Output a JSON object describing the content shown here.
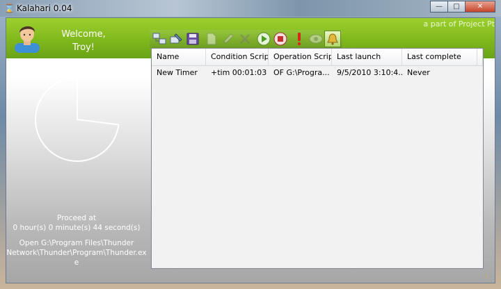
{
  "window": {
    "title": "Kalahari 0.04",
    "title_icon": "hourglass-icon",
    "controls": {
      "minimize": "—",
      "maximize": "□",
      "close": "✕"
    }
  },
  "header": {
    "welcome_line1": "Welcome,",
    "welcome_line2": "Troy!",
    "part_of": "a part of Project Pt",
    "avatar_icon": "user-avatar-icon",
    "accent_color": "#7fb81d"
  },
  "timer": {
    "pie_remaining_fraction": 0.27,
    "proceed_label": "Proceed at",
    "remaining": "0 hour(s) 0 minute(s) 44 second(s)",
    "open_action_line1": "Open G:\\Program Files\\Thunder",
    "open_action_line2": "Network\\Thunder\\Program\\Thunder.ex",
    "open_action_line3": "e"
  },
  "toolbar": {
    "buttons": [
      {
        "icon": "network-icon",
        "enabled": true
      },
      {
        "icon": "network-edit-icon",
        "enabled": true
      },
      {
        "icon": "save-icon",
        "enabled": true
      },
      {
        "icon": "new-document-icon",
        "enabled": false
      },
      {
        "icon": "edit-pencil-icon",
        "enabled": false
      },
      {
        "icon": "delete-cross-icon",
        "enabled": false
      },
      {
        "icon": "play-icon",
        "enabled": true
      },
      {
        "icon": "stop-icon",
        "enabled": true
      },
      {
        "icon": "alert-exclamation-icon",
        "enabled": true
      },
      {
        "icon": "view-eye-icon",
        "enabled": false
      },
      {
        "icon": "bell-icon",
        "enabled": true,
        "active": true
      }
    ]
  },
  "list": {
    "columns": [
      "Name",
      "Condition Script",
      "Operation Script",
      "Last launch",
      "Last complete"
    ],
    "rows": [
      {
        "name": "New Timer",
        "condition": "+tim 00:01:03",
        "operation": "OF G:\\Progra...",
        "last_launch": "9/5/2010 3:10:4...",
        "last_complete": "Never"
      }
    ]
  }
}
